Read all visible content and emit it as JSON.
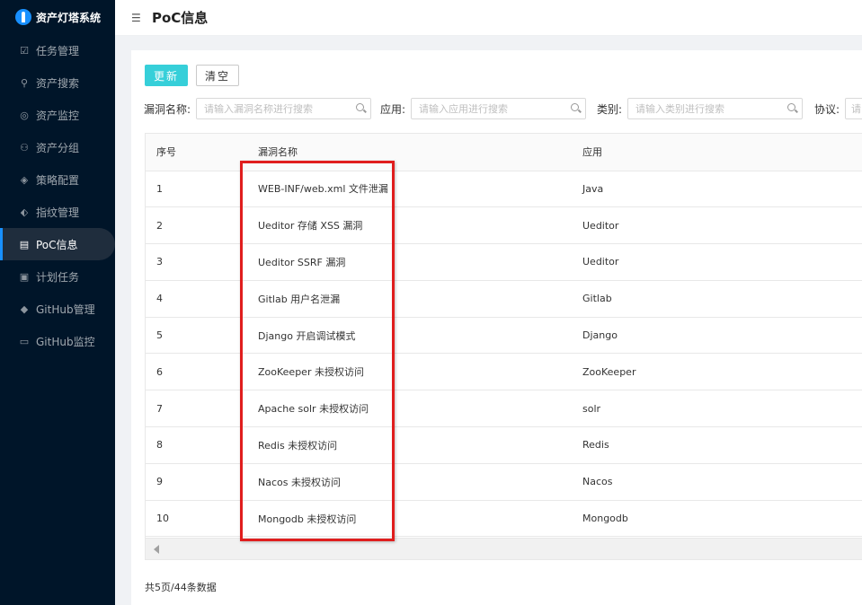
{
  "app": {
    "title": "资产灯塔系统"
  },
  "sidebar": {
    "items": [
      {
        "label": "任务管理",
        "icon": "clipboard-icon",
        "glyph": "☑"
      },
      {
        "label": "资产搜索",
        "icon": "search-icon",
        "glyph": "⚲"
      },
      {
        "label": "资产监控",
        "icon": "monitor-icon",
        "glyph": "◎"
      },
      {
        "label": "资产分组",
        "icon": "org-chart-icon",
        "glyph": "⚇"
      },
      {
        "label": "策略配置",
        "icon": "policy-icon",
        "glyph": "◈"
      },
      {
        "label": "指纹管理",
        "icon": "tag-icon",
        "glyph": "⬖"
      },
      {
        "label": "PoC信息",
        "icon": "document-icon",
        "glyph": "▤",
        "active": true
      },
      {
        "label": "计划任务",
        "icon": "schedule-icon",
        "glyph": "▣"
      },
      {
        "label": "GitHub管理",
        "icon": "diamond-icon",
        "glyph": "◆"
      },
      {
        "label": "GitHub监控",
        "icon": "screen-icon",
        "glyph": "▭"
      }
    ]
  },
  "header": {
    "title": "PoC信息",
    "fold_glyph": "☰"
  },
  "toolbar": {
    "update_label": "更新",
    "clear_label": "清空"
  },
  "filters": {
    "vuln_name": {
      "label": "漏洞名称:",
      "placeholder": "请输入漏洞名称进行搜索"
    },
    "app": {
      "label": "应用:",
      "placeholder": "请输入应用进行搜索"
    },
    "category": {
      "label": "类别:",
      "placeholder": "请输入类别进行搜索"
    },
    "protocol": {
      "label": "协议:",
      "placeholder": "请"
    }
  },
  "table": {
    "headers": [
      "序号",
      "漏洞名称",
      "应用"
    ],
    "rows": [
      [
        "1",
        "WEB-INF/web.xml 文件泄漏",
        "Java"
      ],
      [
        "2",
        "Ueditor 存储 XSS 漏洞",
        "Ueditor"
      ],
      [
        "3",
        "Ueditor SSRF 漏洞",
        "Ueditor"
      ],
      [
        "4",
        "Gitlab 用户名泄漏",
        "Gitlab"
      ],
      [
        "5",
        "Django 开启调试模式",
        "Django"
      ],
      [
        "6",
        "ZooKeeper 未授权访问",
        "ZooKeeper"
      ],
      [
        "7",
        "Apache solr 未授权访问",
        "solr"
      ],
      [
        "8",
        "Redis 未授权访问",
        "Redis"
      ],
      [
        "9",
        "Nacos 未授权访问",
        "Nacos"
      ],
      [
        "10",
        "Mongodb 未授权访问",
        "Mongodb"
      ]
    ]
  },
  "footer": {
    "summary": "共5页/44条数据"
  },
  "colors": {
    "sidebar_bg": "#001529",
    "accent": "#1890ff",
    "update_button": "#36cfd9",
    "highlight": "#e01e1e"
  }
}
